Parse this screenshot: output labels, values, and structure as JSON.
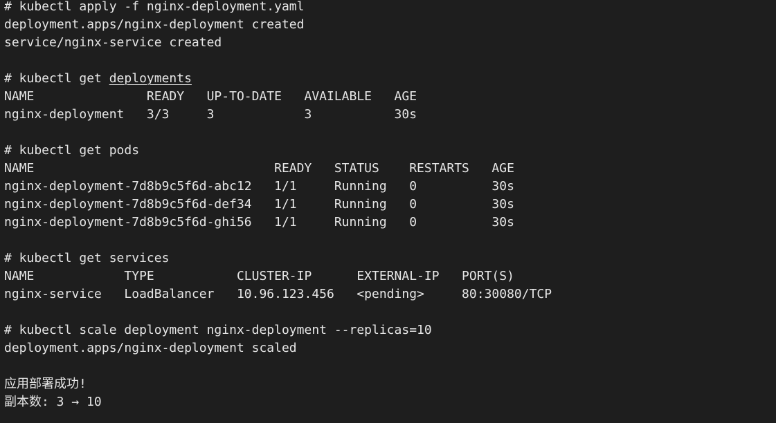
{
  "terminal": {
    "lines": [
      {
        "parts": [
          {
            "text": "# kubectl apply -f nginx-deployment.yaml"
          }
        ]
      },
      {
        "parts": [
          {
            "text": "deployment.apps/nginx-deployment created"
          }
        ]
      },
      {
        "parts": [
          {
            "text": "service/nginx-service created"
          }
        ]
      },
      {
        "parts": [
          {
            "text": ""
          }
        ]
      },
      {
        "parts": [
          {
            "text": "# kubectl get "
          },
          {
            "text": "deployments",
            "underline": true
          }
        ]
      },
      {
        "parts": [
          {
            "text": "NAME               READY   UP-TO-DATE   AVAILABLE   AGE"
          }
        ]
      },
      {
        "parts": [
          {
            "text": "nginx-deployment   3/3     3            3           30s"
          }
        ]
      },
      {
        "parts": [
          {
            "text": ""
          }
        ]
      },
      {
        "parts": [
          {
            "text": "# kubectl get pods"
          }
        ]
      },
      {
        "parts": [
          {
            "text": "NAME                                READY   STATUS    RESTARTS   AGE"
          }
        ]
      },
      {
        "parts": [
          {
            "text": "nginx-deployment-7d8b9c5f6d-abc12   1/1     Running   0          30s"
          }
        ]
      },
      {
        "parts": [
          {
            "text": "nginx-deployment-7d8b9c5f6d-def34   1/1     Running   0          30s"
          }
        ]
      },
      {
        "parts": [
          {
            "text": "nginx-deployment-7d8b9c5f6d-ghi56   1/1     Running   0          30s"
          }
        ]
      },
      {
        "parts": [
          {
            "text": ""
          }
        ]
      },
      {
        "parts": [
          {
            "text": "# kubectl get services"
          }
        ]
      },
      {
        "parts": [
          {
            "text": "NAME            TYPE           CLUSTER-IP      EXTERNAL-IP   PORT(S)"
          }
        ]
      },
      {
        "parts": [
          {
            "text": "nginx-service   LoadBalancer   10.96.123.456   <pending>     80:30080/TCP"
          }
        ]
      },
      {
        "parts": [
          {
            "text": ""
          }
        ]
      },
      {
        "parts": [
          {
            "text": "# kubectl scale deployment nginx-deployment --replicas=10"
          }
        ]
      },
      {
        "parts": [
          {
            "text": "deployment.apps/nginx-deployment scaled"
          }
        ]
      },
      {
        "parts": [
          {
            "text": ""
          }
        ]
      },
      {
        "parts": [
          {
            "text": "应用部署成功!"
          }
        ]
      },
      {
        "parts": [
          {
            "text": "副本数: 3 → 10"
          }
        ]
      }
    ]
  },
  "colors": {
    "background": "#1e1e1e",
    "foreground": "#e6e6e6"
  }
}
